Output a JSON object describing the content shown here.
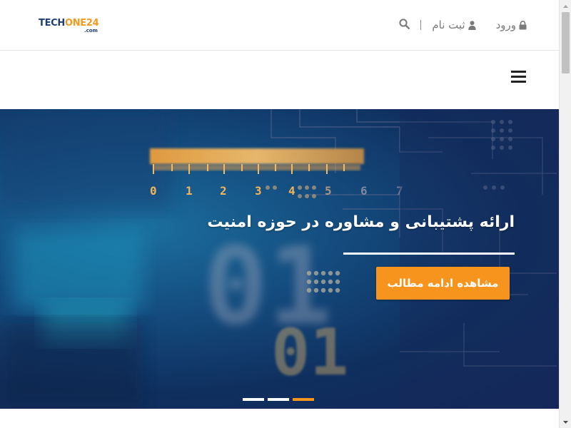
{
  "brand": {
    "logo_prefix": "TECH",
    "logo_accent": "ONE24",
    "logo_sub": ".com",
    "color_primary": "#1d3f73",
    "color_accent": "#f39a1d"
  },
  "header": {
    "login_label": "ورود",
    "login_icon": "lock-icon",
    "register_label": "ثبت نام",
    "register_icon": "user-icon",
    "search_icon": "search-icon"
  },
  "nav": {
    "menu_icon": "hamburger-menu-icon"
  },
  "hero": {
    "title": "ارائه پشتیبانی و مشاوره در حوزه امنیت",
    "cta_label": "مشاهده ادامه مطالب",
    "cta_color": "#f7941e",
    "slides_total": 3,
    "active_slide": 3,
    "digits_row": [
      "0",
      "1",
      "2",
      "3",
      "4",
      "5",
      "6",
      "7"
    ],
    "big_digits": [
      "01",
      "01"
    ]
  }
}
